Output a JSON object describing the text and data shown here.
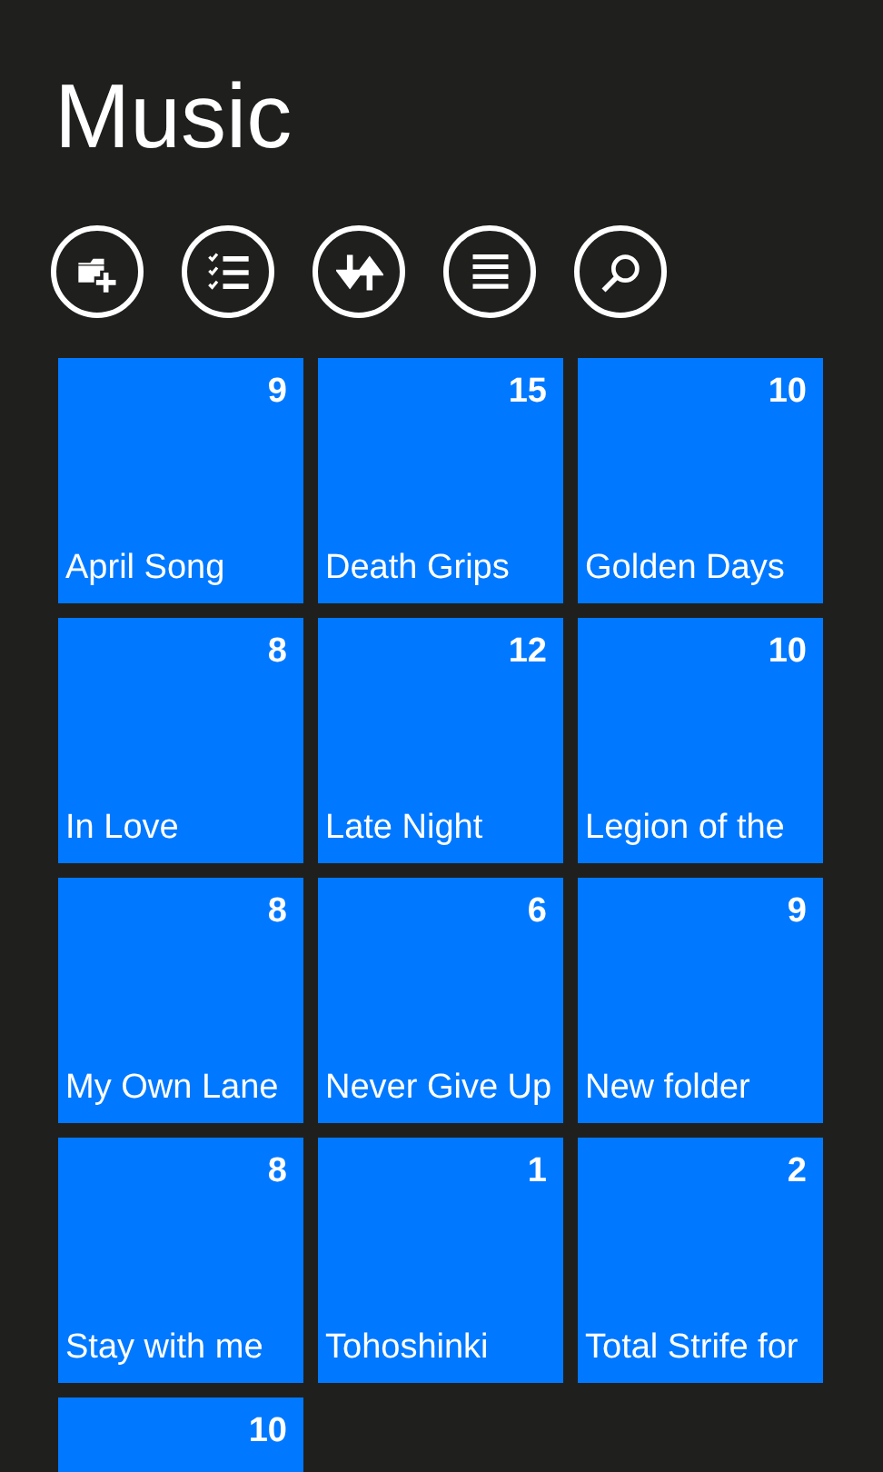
{
  "title": "Music",
  "toolbar": [
    {
      "kind": "add-folder"
    },
    {
      "kind": "select"
    },
    {
      "kind": "sort"
    },
    {
      "kind": "list"
    },
    {
      "kind": "search"
    }
  ],
  "folders": [
    {
      "name": "April Song",
      "count": "9"
    },
    {
      "name": "Death Grips",
      "count": "15"
    },
    {
      "name": "Golden Days",
      "count": "10"
    },
    {
      "name": "In Love",
      "count": "8"
    },
    {
      "name": "Late Night",
      "count": "12"
    },
    {
      "name": "Legion of the",
      "count": "10"
    },
    {
      "name": "My Own Lane",
      "count": "8"
    },
    {
      "name": "Never Give Up",
      "count": "6"
    },
    {
      "name": "New folder",
      "count": "9"
    },
    {
      "name": "Stay with me",
      "count": "8"
    },
    {
      "name": "Tohoshinki",
      "count": "1"
    },
    {
      "name": "Total Strife for",
      "count": "2"
    },
    {
      "count": "10"
    }
  ]
}
